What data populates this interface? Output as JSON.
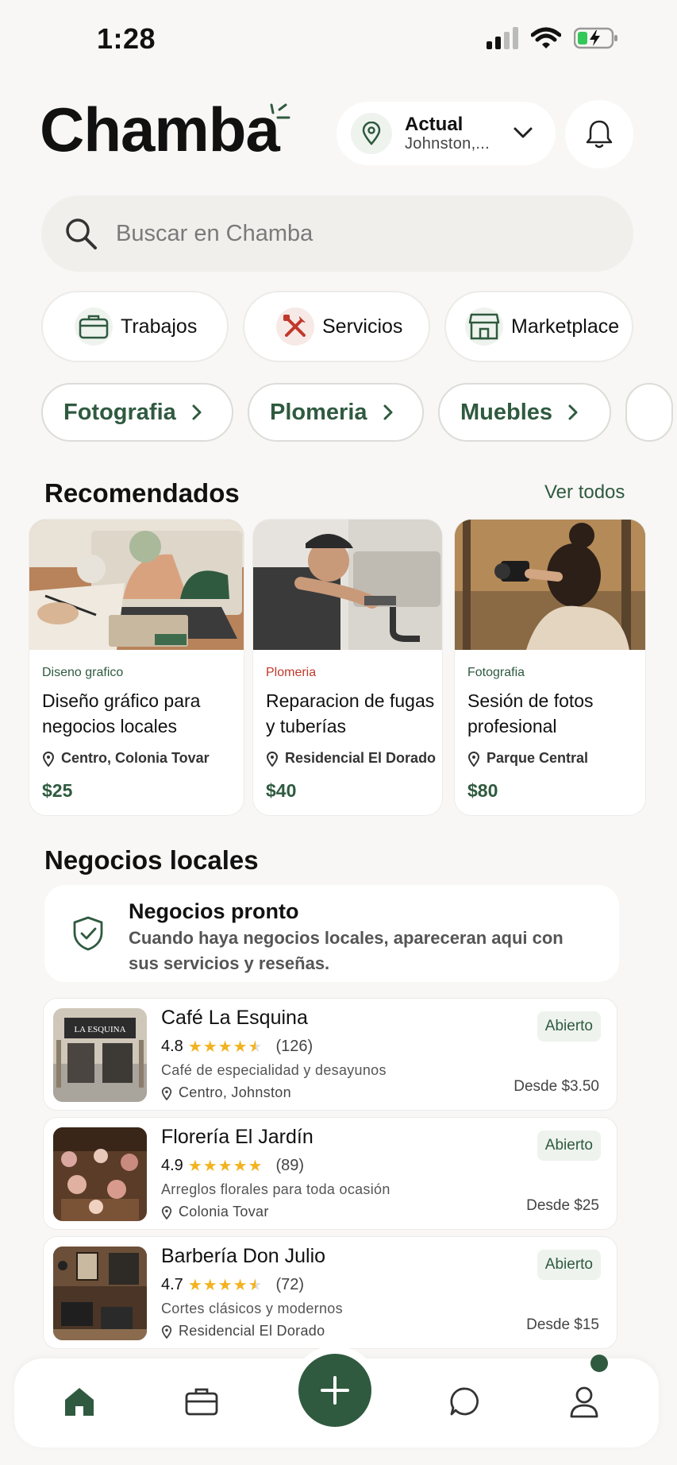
{
  "status_bar": {
    "time": "1:28"
  },
  "header": {
    "logo": "Chamba",
    "location": {
      "label": "Actual",
      "value": "Johnston,..."
    }
  },
  "search": {
    "placeholder": "Buscar en Chamba"
  },
  "categories": [
    {
      "label": "Trabajos",
      "icon": "briefcase-icon"
    },
    {
      "label": "Servicios",
      "icon": "tools-icon"
    },
    {
      "label": "Marketplace",
      "icon": "store-icon"
    }
  ],
  "subcategories": [
    "Fotografia",
    "Plomeria",
    "Muebles"
  ],
  "recommended": {
    "title": "Recomendados",
    "see_all": "Ver todos",
    "items": [
      {
        "tag": "Diseno grafico",
        "tag_color": "#2f5a3f",
        "title": "Diseño gráfico para negocios locales",
        "location": "Centro, Colonia Tovar",
        "price": "$25"
      },
      {
        "tag": "Plomeria",
        "tag_color": "#c0392b",
        "title": "Reparacion de fugas y tuberías",
        "location": "Residencial El Dorado",
        "price": "$40"
      },
      {
        "tag": "Fotografia",
        "tag_color": "#2f5a3f",
        "title": "Sesión de fotos profesional",
        "location": "Parque Central",
        "price": "$80"
      }
    ]
  },
  "local": {
    "title": "Negocios locales",
    "notice": {
      "title": "Negocios pronto",
      "text": "Cuando haya negocios locales, apareceran aqui con sus servicios y reseñas."
    },
    "businesses": [
      {
        "name": "Café La Esquina",
        "rating": "4.8",
        "stars": 4.5,
        "reviews": "(126)",
        "desc": "Café de especialidad y desayunos",
        "location": "Centro, Johnston",
        "status": "Abierto",
        "from": "Desde $3.50",
        "sign": "LA ESQUINA"
      },
      {
        "name": "Florería El Jardín",
        "rating": "4.9",
        "stars": 5,
        "reviews": "(89)",
        "desc": "Arreglos florales para toda ocasión",
        "location": "Colonia Tovar",
        "status": "Abierto",
        "from": "Desde $25",
        "sign": ""
      },
      {
        "name": "Barbería Don Julio",
        "rating": "4.7",
        "stars": 4.5,
        "reviews": "(72)",
        "desc": "Cortes clásicos y modernos",
        "location": "Residencial El Dorado",
        "status": "Abierto",
        "from": "Desde $15",
        "sign": ""
      }
    ]
  },
  "bottom_nav": [
    "home-icon",
    "briefcase-icon",
    "add-icon",
    "chat-icon",
    "profile-icon"
  ],
  "colors": {
    "accent": "#2f5a3f",
    "background": "#f8f7f5",
    "star": "#f2b320"
  }
}
